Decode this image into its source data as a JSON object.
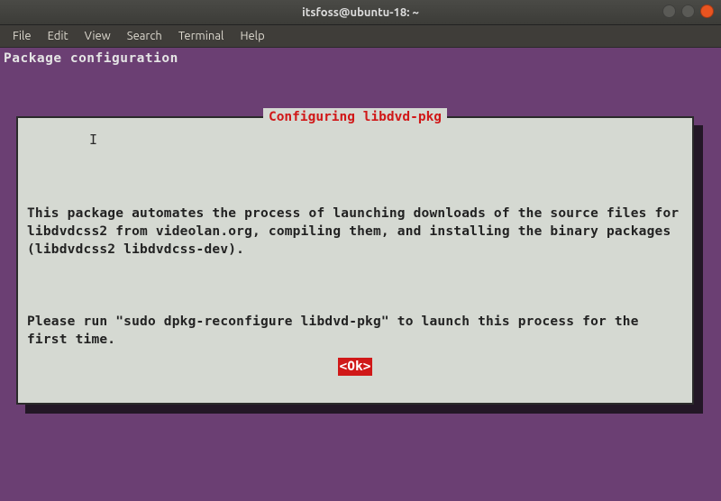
{
  "window": {
    "title": "itsfoss@ubuntu-18: ~"
  },
  "menubar": {
    "items": [
      "File",
      "Edit",
      "View",
      "Search",
      "Terminal",
      "Help"
    ]
  },
  "terminal": {
    "header": "Package configuration"
  },
  "dialog": {
    "title": " Configuring libdvd-pkg ",
    "para1": "This package automates the process of launching downloads of the source files for libdvdcss2 from videolan.org, compiling them, and installing the binary packages (libdvdcss2 libdvdcss-dev).",
    "para2": "Please run \"sudo dpkg-reconfigure libdvd-pkg\" to launch this process for the first time.",
    "ok_label": "<Ok>"
  }
}
